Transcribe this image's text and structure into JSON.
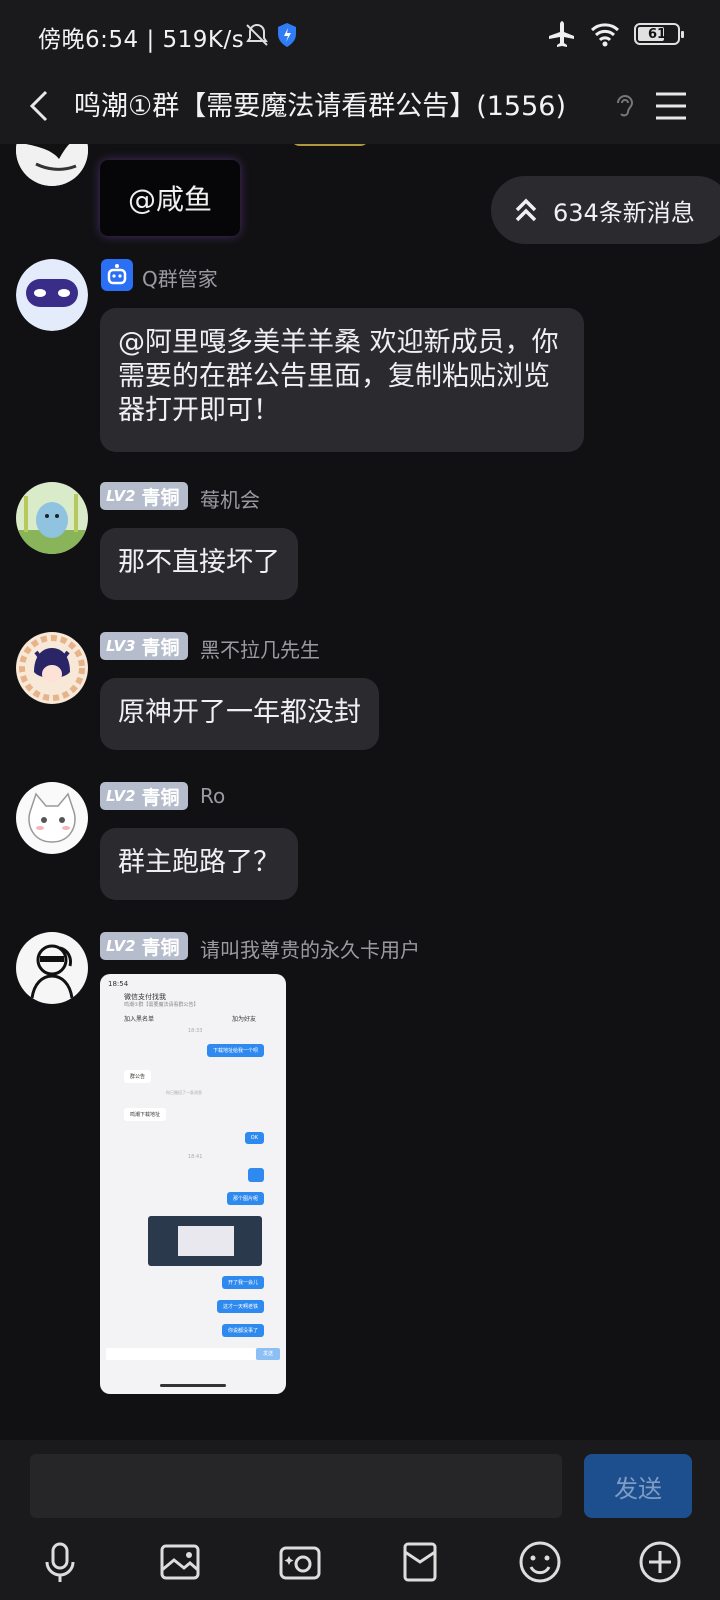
{
  "status": {
    "time": "傍晚6:54 | 519K/s",
    "battery": "61"
  },
  "header": {
    "title": "鸣潮①群【需要魔法请看群公告】(1556)"
  },
  "new_messages": "634条新消息",
  "messages": [
    {
      "text": "@咸鱼"
    },
    {
      "sender": "Q群管家",
      "text": "@阿里嘎多美羊羊桑 欢迎新成员，你需要的在群公告里面，复制粘贴浏览器打开即可！"
    },
    {
      "level": "LV2",
      "rank": "青铜",
      "sender": "莓机会",
      "text": "那不直接坏了"
    },
    {
      "level": "LV3",
      "rank": "青铜",
      "sender": "黑不拉几先生",
      "text": "原神开了一年都没封"
    },
    {
      "level": "LV2",
      "rank": "青铜",
      "sender": "Ro",
      "text": "群主跑路了？"
    },
    {
      "level": "LV2",
      "rank": "青铜",
      "sender": "请叫我尊贵的永久卡用户"
    }
  ],
  "screenshot": {
    "time": "18:54",
    "title": "微信支付找我",
    "subtitle": "鸣潮①群【需要魔法请看群公告】",
    "blacklist": "加入黑名单",
    "add_friend": "加为好友",
    "ts1": "18:33",
    "ts2": "18:41",
    "sys1": "你已撤回了一条消息",
    "lines": [
      "下载地址给我一个呗",
      "群公告",
      "鸣潮下载地址",
      "OK",
      "那个图片呢",
      "开了我一会儿",
      "这才一天啊老铁",
      "你说都没事了"
    ],
    "send": "发送"
  },
  "input": {
    "placeholder": "",
    "send_label": "发送"
  },
  "toolbar": [
    "mic-icon",
    "image-icon",
    "camera-icon",
    "red-packet-icon",
    "emoji-icon",
    "plus-icon"
  ]
}
